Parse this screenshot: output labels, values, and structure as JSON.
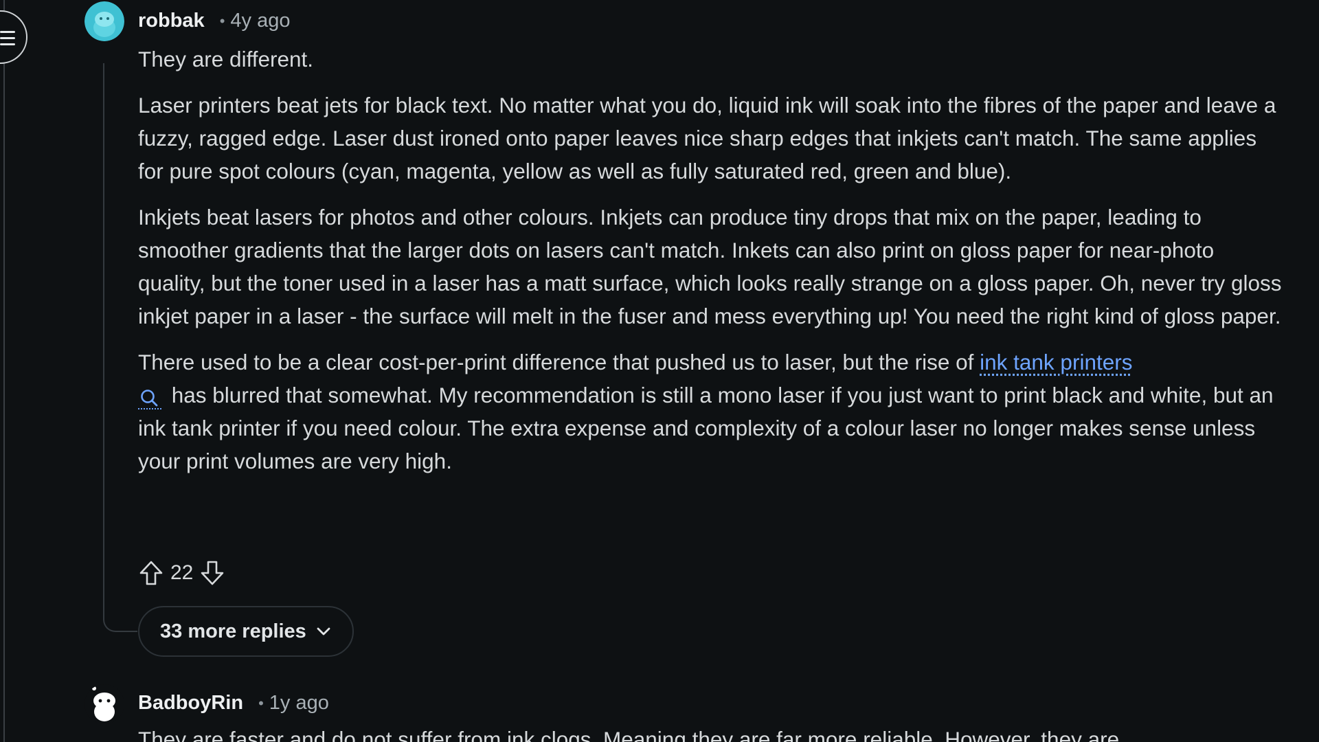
{
  "navigation": {
    "menu_icon": "hamburger-menu-icon"
  },
  "comments": [
    {
      "author": "robbak",
      "separator": "•",
      "time": "4y ago",
      "avatar_color": "#3fc1d3",
      "paragraphs": [
        "They are different.",
        "Laser printers beat jets for black text. No matter what you do, liquid ink will soak into the fibres of the paper and leave a fuzzy, ragged edge. Laser dust ironed onto paper leaves nice sharp edges that inkjets can't match. The same applies for pure spot colours (cyan, magenta, yellow as well as fully saturated red, green and blue).",
        "Inkjets beat lasers for photos and other colours. Inkjets can produce tiny drops that mix on the paper, leading to smoother gradients that the larger dots on lasers can't match. Inkets can also print on gloss paper for near-photo quality, but the toner used in a laser has a matt surface, which looks really strange on a gloss paper. Oh, never try gloss inkjet paper in a laser - the surface will melt in the fuser and mess everything up! You need the right kind of gloss paper."
      ],
      "last_paragraph": {
        "before_link": "There used to be a clear cost-per-print difference that pushed us to laser, but the rise of ",
        "link_text": "ink tank printers",
        "after_link": " has blurred that somewhat. My recommendation is still a mono laser if you just want to print black and white, but an ink tank printer if you need colour. The extra expense and complexity of a colour laser no longer makes sense unless your print volumes are very high."
      },
      "score": "22",
      "more_replies": "33 more replies"
    },
    {
      "author": "BadboyRin",
      "separator": "•",
      "time": "1y ago",
      "avatar_color": "#ffffff",
      "preview": "They are faster and do not suffer from ink clogs. Meaning they are far more reliable. However, they are"
    }
  ],
  "colors": {
    "background": "#0e1113",
    "link": "#6ea4ff",
    "text": "#d7dadc"
  }
}
